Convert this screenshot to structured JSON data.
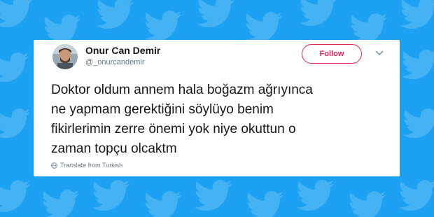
{
  "background": {
    "color": "#1da1f2",
    "pattern_icon": "twitter-bird-icon"
  },
  "tweet": {
    "author": {
      "name": "Onur Can Demir",
      "handle": "@_onurcandemir",
      "avatar_icon": "avatar"
    },
    "follow_button": {
      "label": "Follow",
      "color": "#e0245e"
    },
    "menu_icon": "chevron-down-icon",
    "lines": [
      "Doktor oldum annem hala boğazm ağrıyınca",
      "ne yapmam gerektiğini söylüyo benim",
      "fikirlerimin zerre önemi yok niye okuttun o",
      "zaman topçu olcaktm"
    ],
    "translate": {
      "label": "Translate from Turkish",
      "icon": "globe-icon"
    }
  }
}
